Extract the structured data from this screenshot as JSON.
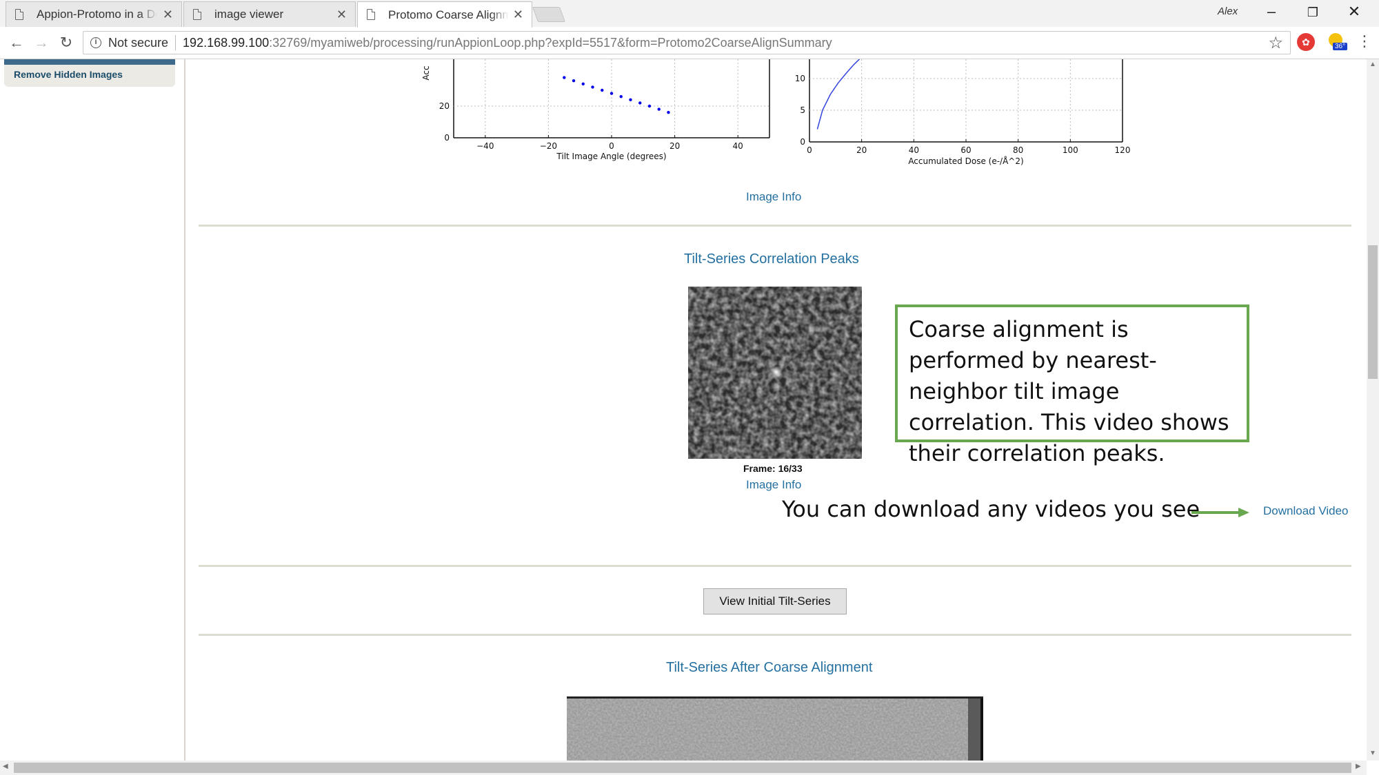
{
  "browser": {
    "tabs": [
      {
        "label": "Appion-Protomo in a Do"
      },
      {
        "label": "image viewer"
      },
      {
        "label": "Protomo Coarse Alignme"
      }
    ],
    "profile_name": "Alex",
    "security_label": "Not secure",
    "url_host": "192.168.99.100",
    "url_path": ":32769/myamiweb/processing/runAppionLoop.php?expId=5517&form=Protomo2CoarseAlignSummary",
    "ext_badge": "36°"
  },
  "sidebar": {
    "link_label": "Remove Hidden Images"
  },
  "plots": {
    "left": {
      "ylabel": "Acc",
      "xlabel": "Tilt Image Angle (degrees)",
      "x_ticks": [
        "−40",
        "−20",
        "0",
        "20",
        "40"
      ],
      "y_ticks": [
        "0",
        "20"
      ]
    },
    "right": {
      "xlabel": "Accumulated Dose (e-/Å^2)",
      "x_ticks": [
        "0",
        "20",
        "40",
        "60",
        "80",
        "100",
        "120"
      ],
      "y_ticks": [
        "0",
        "5",
        "10"
      ]
    },
    "image_info_label": "Image Info"
  },
  "chart_data": [
    {
      "type": "scatter",
      "xlabel": "Tilt Image Angle (degrees)",
      "ylabel": "Acc",
      "xlim": [
        -50,
        50
      ],
      "x": [
        -15,
        -12,
        -9,
        -6,
        -3,
        0,
        3,
        6,
        9,
        12,
        15,
        18
      ],
      "y": [
        38,
        36,
        34,
        32,
        30,
        28,
        26,
        24,
        22,
        20,
        18,
        16
      ],
      "color": "#0000ee"
    },
    {
      "type": "line",
      "xlabel": "Accumulated Dose (e-/Å^2)",
      "xlim": [
        0,
        120
      ],
      "ylim": [
        0,
        14
      ],
      "x": [
        3,
        5,
        8,
        11,
        14,
        17,
        20,
        22
      ],
      "y": [
        2,
        5,
        7.5,
        9.3,
        10.8,
        12.2,
        13.4,
        14
      ],
      "color": "#3344dd"
    }
  ],
  "correlation": {
    "title": "Tilt-Series Correlation Peaks",
    "frame_label": "Frame: 16/33",
    "image_info_label": "Image Info",
    "callout_text": "Coarse alignment is performed by nearest-neighbor tilt image correlation. This video shows their correlation peaks.",
    "download_note": "You can download any videos you see",
    "download_link": "Download Video"
  },
  "initial_series": {
    "button_label": "View Initial Tilt-Series"
  },
  "aligned_series": {
    "title": "Tilt-Series After Coarse Alignment"
  }
}
